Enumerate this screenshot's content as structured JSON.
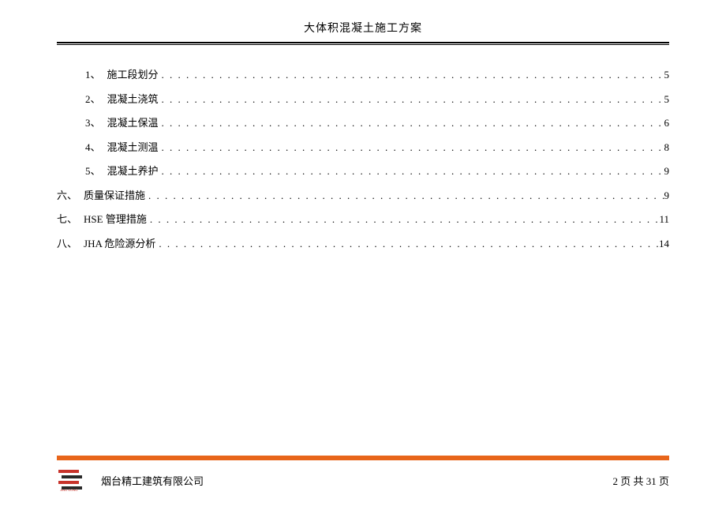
{
  "header": {
    "title": "大体积混凝土施工方案"
  },
  "toc": [
    {
      "indent": 1,
      "num": "1、",
      "label": "施工段划分",
      "page": "5"
    },
    {
      "indent": 1,
      "num": "2、",
      "label": "混凝土浇筑",
      "page": "5"
    },
    {
      "indent": 1,
      "num": "3、",
      "label": "混凝土保温",
      "page": "6"
    },
    {
      "indent": 1,
      "num": "4、",
      "label": "混凝土测温",
      "page": "8"
    },
    {
      "indent": 1,
      "num": "5、",
      "label": "混凝土养护",
      "page": "9"
    },
    {
      "indent": 0,
      "num": "六、",
      "label": "质量保证措施",
      "page": "9"
    },
    {
      "indent": 0,
      "num": "七、",
      "label": "HSE 管理措施",
      "page": "11"
    },
    {
      "indent": 0,
      "num": "八、",
      "label": "JHA 危险源分析",
      "page": "14"
    }
  ],
  "footer": {
    "company": "烟台精工建筑有限公司",
    "page_current": "2",
    "page_total": "31",
    "page_label_1": "页 共",
    "page_label_2": "页"
  }
}
